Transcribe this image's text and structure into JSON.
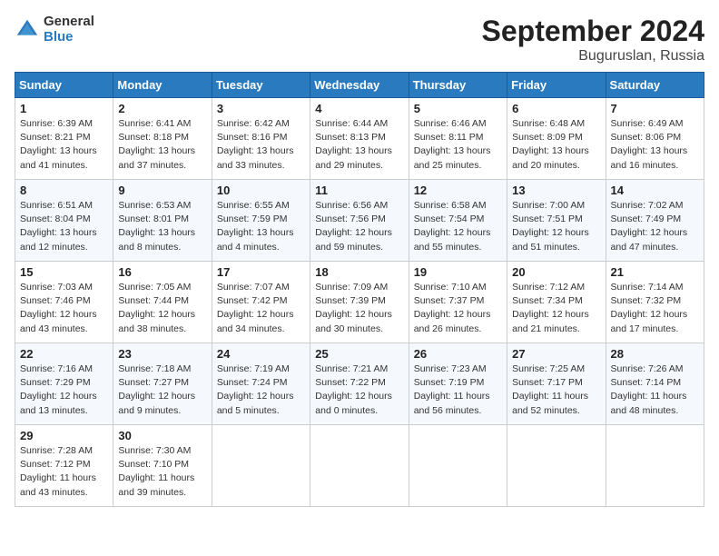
{
  "header": {
    "logo_line1": "General",
    "logo_line2": "Blue",
    "title": "September 2024",
    "subtitle": "Buguruslan, Russia"
  },
  "calendar": {
    "headers": [
      "Sunday",
      "Monday",
      "Tuesday",
      "Wednesday",
      "Thursday",
      "Friday",
      "Saturday"
    ],
    "weeks": [
      [
        {
          "day": "",
          "detail": ""
        },
        {
          "day": "2",
          "detail": "Sunrise: 6:41 AM\nSunset: 8:18 PM\nDaylight: 13 hours\nand 37 minutes."
        },
        {
          "day": "3",
          "detail": "Sunrise: 6:42 AM\nSunset: 8:16 PM\nDaylight: 13 hours\nand 33 minutes."
        },
        {
          "day": "4",
          "detail": "Sunrise: 6:44 AM\nSunset: 8:13 PM\nDaylight: 13 hours\nand 29 minutes."
        },
        {
          "day": "5",
          "detail": "Sunrise: 6:46 AM\nSunset: 8:11 PM\nDaylight: 13 hours\nand 25 minutes."
        },
        {
          "day": "6",
          "detail": "Sunrise: 6:48 AM\nSunset: 8:09 PM\nDaylight: 13 hours\nand 20 minutes."
        },
        {
          "day": "7",
          "detail": "Sunrise: 6:49 AM\nSunset: 8:06 PM\nDaylight: 13 hours\nand 16 minutes."
        }
      ],
      [
        {
          "day": "8",
          "detail": "Sunrise: 6:51 AM\nSunset: 8:04 PM\nDaylight: 13 hours\nand 12 minutes."
        },
        {
          "day": "9",
          "detail": "Sunrise: 6:53 AM\nSunset: 8:01 PM\nDaylight: 13 hours\nand 8 minutes."
        },
        {
          "day": "10",
          "detail": "Sunrise: 6:55 AM\nSunset: 7:59 PM\nDaylight: 13 hours\nand 4 minutes."
        },
        {
          "day": "11",
          "detail": "Sunrise: 6:56 AM\nSunset: 7:56 PM\nDaylight: 12 hours\nand 59 minutes."
        },
        {
          "day": "12",
          "detail": "Sunrise: 6:58 AM\nSunset: 7:54 PM\nDaylight: 12 hours\nand 55 minutes."
        },
        {
          "day": "13",
          "detail": "Sunrise: 7:00 AM\nSunset: 7:51 PM\nDaylight: 12 hours\nand 51 minutes."
        },
        {
          "day": "14",
          "detail": "Sunrise: 7:02 AM\nSunset: 7:49 PM\nDaylight: 12 hours\nand 47 minutes."
        }
      ],
      [
        {
          "day": "15",
          "detail": "Sunrise: 7:03 AM\nSunset: 7:46 PM\nDaylight: 12 hours\nand 43 minutes."
        },
        {
          "day": "16",
          "detail": "Sunrise: 7:05 AM\nSunset: 7:44 PM\nDaylight: 12 hours\nand 38 minutes."
        },
        {
          "day": "17",
          "detail": "Sunrise: 7:07 AM\nSunset: 7:42 PM\nDaylight: 12 hours\nand 34 minutes."
        },
        {
          "day": "18",
          "detail": "Sunrise: 7:09 AM\nSunset: 7:39 PM\nDaylight: 12 hours\nand 30 minutes."
        },
        {
          "day": "19",
          "detail": "Sunrise: 7:10 AM\nSunset: 7:37 PM\nDaylight: 12 hours\nand 26 minutes."
        },
        {
          "day": "20",
          "detail": "Sunrise: 7:12 AM\nSunset: 7:34 PM\nDaylight: 12 hours\nand 21 minutes."
        },
        {
          "day": "21",
          "detail": "Sunrise: 7:14 AM\nSunset: 7:32 PM\nDaylight: 12 hours\nand 17 minutes."
        }
      ],
      [
        {
          "day": "22",
          "detail": "Sunrise: 7:16 AM\nSunset: 7:29 PM\nDaylight: 12 hours\nand 13 minutes."
        },
        {
          "day": "23",
          "detail": "Sunrise: 7:18 AM\nSunset: 7:27 PM\nDaylight: 12 hours\nand 9 minutes."
        },
        {
          "day": "24",
          "detail": "Sunrise: 7:19 AM\nSunset: 7:24 PM\nDaylight: 12 hours\nand 5 minutes."
        },
        {
          "day": "25",
          "detail": "Sunrise: 7:21 AM\nSunset: 7:22 PM\nDaylight: 12 hours\nand 0 minutes."
        },
        {
          "day": "26",
          "detail": "Sunrise: 7:23 AM\nSunset: 7:19 PM\nDaylight: 11 hours\nand 56 minutes."
        },
        {
          "day": "27",
          "detail": "Sunrise: 7:25 AM\nSunset: 7:17 PM\nDaylight: 11 hours\nand 52 minutes."
        },
        {
          "day": "28",
          "detail": "Sunrise: 7:26 AM\nSunset: 7:14 PM\nDaylight: 11 hours\nand 48 minutes."
        }
      ],
      [
        {
          "day": "29",
          "detail": "Sunrise: 7:28 AM\nSunset: 7:12 PM\nDaylight: 11 hours\nand 43 minutes."
        },
        {
          "day": "30",
          "detail": "Sunrise: 7:30 AM\nSunset: 7:10 PM\nDaylight: 11 hours\nand 39 minutes."
        },
        {
          "day": "",
          "detail": ""
        },
        {
          "day": "",
          "detail": ""
        },
        {
          "day": "",
          "detail": ""
        },
        {
          "day": "",
          "detail": ""
        },
        {
          "day": "",
          "detail": ""
        }
      ]
    ],
    "week0": {
      "sun": {
        "day": "1",
        "detail": "Sunrise: 6:39 AM\nSunset: 8:21 PM\nDaylight: 13 hours\nand 41 minutes."
      }
    }
  }
}
